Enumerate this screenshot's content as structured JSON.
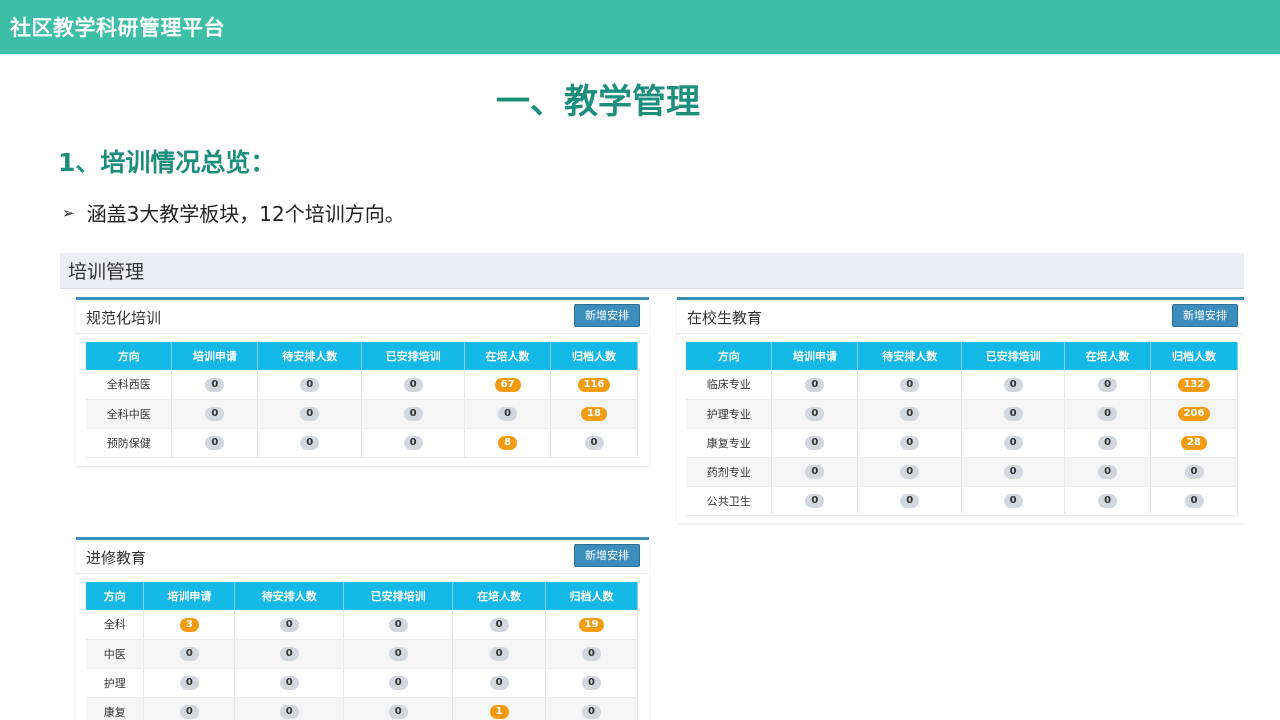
{
  "header": {
    "brand": "社区教学科研管理平台"
  },
  "slide": {
    "title": "一、教学管理",
    "section": "1、培训情况总览：",
    "bullet_marker": "➢",
    "bullet": "涵盖3大教学板块，12个培训方向。"
  },
  "screenshot": {
    "title": "培训管理",
    "panels": [
      {
        "title": "规范化培训",
        "button": "新增安排",
        "columns": [
          "方向",
          "培训申请",
          "待安排人数",
          "已安排培训",
          "在培人数",
          "归档人数"
        ],
        "rows": [
          [
            "全科西医",
            "0",
            "0",
            "0",
            "67",
            "116"
          ],
          [
            "全科中医",
            "0",
            "0",
            "0",
            "0",
            "18"
          ],
          [
            "预防保健",
            "0",
            "0",
            "0",
            "8",
            "0"
          ]
        ]
      },
      {
        "title": "在校生教育",
        "button": "新增安排",
        "columns": [
          "方向",
          "培训申请",
          "待安排人数",
          "已安排培训",
          "在培人数",
          "归档人数"
        ],
        "rows": [
          [
            "临床专业",
            "0",
            "0",
            "0",
            "0",
            "132"
          ],
          [
            "护理专业",
            "0",
            "0",
            "0",
            "0",
            "206"
          ],
          [
            "康复专业",
            "0",
            "0",
            "0",
            "0",
            "28"
          ],
          [
            "药剂专业",
            "0",
            "0",
            "0",
            "0",
            "0"
          ],
          [
            "公共卫生",
            "0",
            "0",
            "0",
            "0",
            "0"
          ]
        ]
      },
      {
        "title": "进修教育",
        "button": "新增安排",
        "columns": [
          "方向",
          "培训申请",
          "待安排人数",
          "已安排培训",
          "在培人数",
          "归档人数"
        ],
        "rows": [
          [
            "全科",
            "3",
            "0",
            "0",
            "0",
            "19"
          ],
          [
            "中医",
            "0",
            "0",
            "0",
            "0",
            "0"
          ],
          [
            "护理",
            "0",
            "0",
            "0",
            "0",
            "0"
          ],
          [
            "康复",
            "0",
            "0",
            "0",
            "1",
            "0"
          ]
        ]
      }
    ]
  },
  "colors": {
    "topbar": "#3dbfa7",
    "heading": "#1b8f7c",
    "table_header": "#15b9e8",
    "badge_orange": "#f39c12",
    "badge_gray": "#d2d6de",
    "button": "#3c8dbc"
  }
}
